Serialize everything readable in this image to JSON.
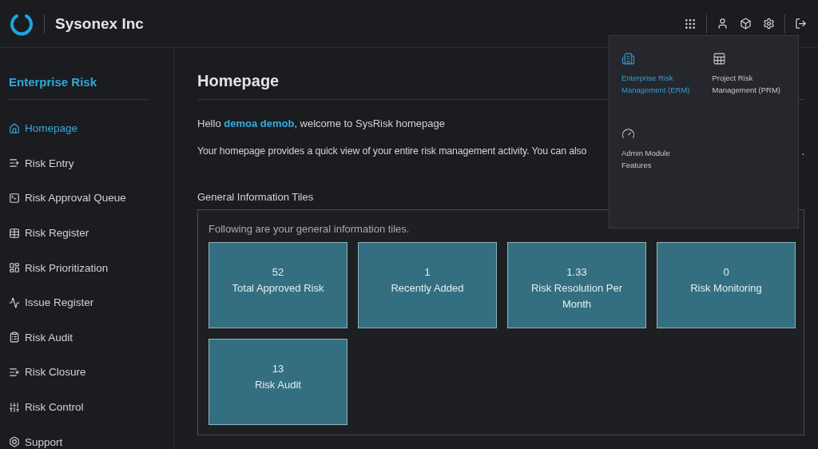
{
  "header": {
    "brand": "Sysonex Inc"
  },
  "sidebar": {
    "title": "Enterprise Risk",
    "items": [
      {
        "label": "Homepage",
        "selected": true
      },
      {
        "label": "Risk Entry",
        "selected": false
      },
      {
        "label": "Risk Approval Queue",
        "selected": false
      },
      {
        "label": "Risk Register",
        "selected": false
      },
      {
        "label": "Risk Prioritization",
        "selected": false
      },
      {
        "label": "Issue Register",
        "selected": false
      },
      {
        "label": "Risk Audit",
        "selected": false
      },
      {
        "label": "Risk Closure",
        "selected": false
      },
      {
        "label": "Risk Control",
        "selected": false
      },
      {
        "label": "Support",
        "selected": false
      }
    ]
  },
  "main": {
    "title": "Homepage",
    "greeting": "Hello **demoa demob**, welcome to SysRisk homepage",
    "intro": "Your homepage provides a quick view of your entire risk management activity. You can also",
    "intro_end": ".",
    "tiles_heading": "General Information Tiles",
    "tiles_note": "Following are your general information tiles.",
    "tiles": [
      {
        "value": "52",
        "label": "Total Approved Risk"
      },
      {
        "value": "1",
        "label": "Recently Added"
      },
      {
        "value": "1.33",
        "label": "Risk Resolution Per Month"
      },
      {
        "value": "0",
        "label": "Risk Monitoring"
      },
      {
        "value": "13",
        "label": "Risk Audit"
      }
    ]
  },
  "app_menu": {
    "items": [
      {
        "label": "Enterprise Risk Management (ERM)",
        "selected": true
      },
      {
        "label": "Project Risk Management (PRM)",
        "selected": false
      },
      {
        "label": "Admin Module Features",
        "selected": false
      }
    ]
  }
}
